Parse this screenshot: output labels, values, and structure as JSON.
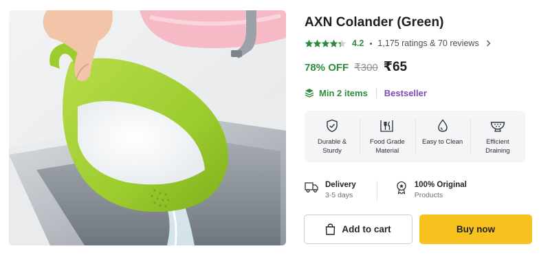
{
  "product": {
    "title": "AXN Colander (Green)",
    "rating": "4.2",
    "stars_filled": 4.2,
    "reviews_text": "1,175 ratings & 70 reviews",
    "discount": "78% OFF",
    "mrp": "₹300",
    "price": "₹65",
    "min_items": "Min 2 items",
    "bestseller": "Bestseller"
  },
  "features": [
    {
      "icon": "shield-check-icon",
      "label": "Durable & Sturdy"
    },
    {
      "icon": "fork-knife-icon",
      "label": "Food Grade Material"
    },
    {
      "icon": "water-drop-icon",
      "label": "Easy to Clean"
    },
    {
      "icon": "strainer-bowl-icon",
      "label": "Efficient Draining"
    }
  ],
  "assurances": [
    {
      "icon": "delivery-truck-icon",
      "title": "Delivery",
      "subtitle": "3-5 days"
    },
    {
      "icon": "badge-ribbon-icon",
      "title": "100% Original",
      "subtitle": "Products"
    }
  ],
  "actions": {
    "add_to_cart": "Add to cart",
    "buy_now": "Buy now"
  },
  "colors": {
    "rating_green": "#2e8b3e",
    "bestseller_purple": "#7b4bb5",
    "buy_yellow": "#f7c21d",
    "product_green": "#9ccc2e"
  }
}
